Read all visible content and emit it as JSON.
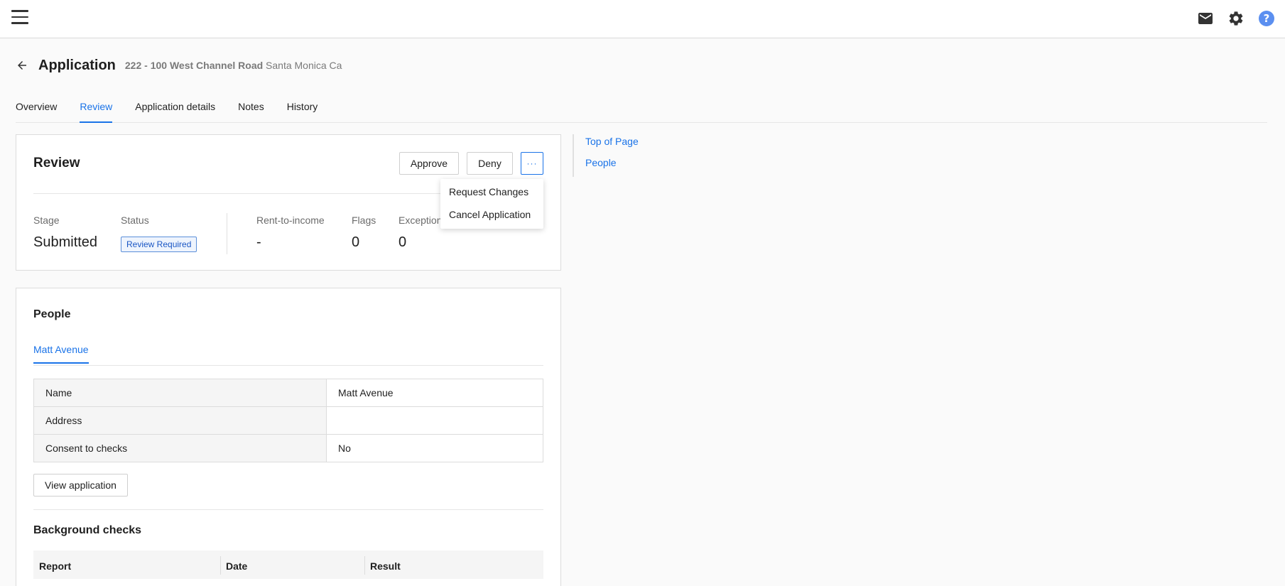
{
  "header": {
    "title": "Application",
    "address_unit": "222 - 100",
    "address_street": "West Channel Road",
    "address_city": "Santa Monica Ca"
  },
  "tabs": [
    {
      "label": "Overview",
      "active": false
    },
    {
      "label": "Review",
      "active": true
    },
    {
      "label": "Application details",
      "active": false
    },
    {
      "label": "Notes",
      "active": false
    },
    {
      "label": "History",
      "active": false
    }
  ],
  "review": {
    "title": "Review",
    "approve_label": "Approve",
    "deny_label": "Deny",
    "more_label": "···",
    "stats": [
      {
        "label": "Stage",
        "value": "Submitted"
      },
      {
        "label": "Status",
        "value": "Review Required"
      },
      {
        "label": "Rent-to-income",
        "value": "-"
      },
      {
        "label": "Flags",
        "value": "0"
      },
      {
        "label": "Exceptions",
        "value": "0"
      }
    ]
  },
  "more_menu": {
    "items": [
      "Request Changes",
      "Cancel Application"
    ]
  },
  "side_nav": {
    "links": [
      "Top of Page",
      "People"
    ]
  },
  "people": {
    "title": "People",
    "person_tab": "Matt Avenue",
    "rows": [
      {
        "key": "Name",
        "value": "Matt Avenue"
      },
      {
        "key": "Address",
        "value": ""
      },
      {
        "key": "Consent to checks",
        "value": "No"
      }
    ],
    "view_application_label": "View application",
    "background_title": "Background checks",
    "background_columns": [
      "Report",
      "Date",
      "Result"
    ]
  },
  "colors": {
    "accent": "#1a73e8",
    "help_icon": "#5b8ff0"
  }
}
